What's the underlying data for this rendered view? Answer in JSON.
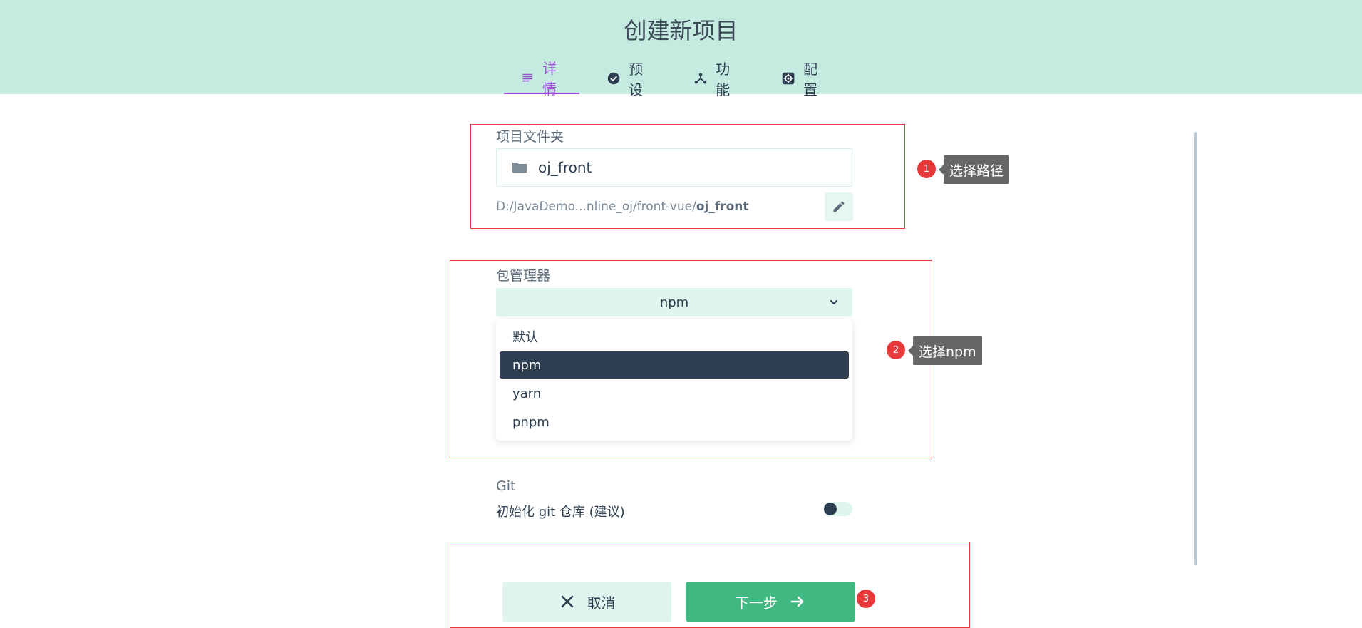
{
  "header": {
    "title": "创建新项目"
  },
  "tabs": [
    {
      "label": "详情",
      "icon": "details-icon",
      "active": true
    },
    {
      "label": "预设",
      "icon": "check-circle-icon",
      "active": false
    },
    {
      "label": "功能",
      "icon": "features-icon",
      "active": false
    },
    {
      "label": "配置",
      "icon": "gear-icon",
      "active": false
    }
  ],
  "folder": {
    "label": "项目文件夹",
    "value": "oj_front",
    "path_prefix": "D:/JavaDemo...nline_oj/front-vue/",
    "path_name": "oj_front"
  },
  "package_manager": {
    "label": "包管理器",
    "selected": "npm",
    "options": [
      "默认",
      "npm",
      "yarn",
      "pnpm"
    ]
  },
  "git": {
    "title": "Git",
    "init_label": "初始化 git 仓库 (建议)",
    "enabled": false
  },
  "buttons": {
    "cancel": "取消",
    "next": "下一步"
  },
  "annotations": {
    "badge1": "1",
    "tip1": "选择路径",
    "badge2": "2",
    "tip2": "选择npm",
    "badge3": "3"
  },
  "colors": {
    "header_bg": "#c5ebe0",
    "accent_purple": "#9d4fdc",
    "primary_green": "#42b883",
    "annotation_red": "#e8393a"
  }
}
